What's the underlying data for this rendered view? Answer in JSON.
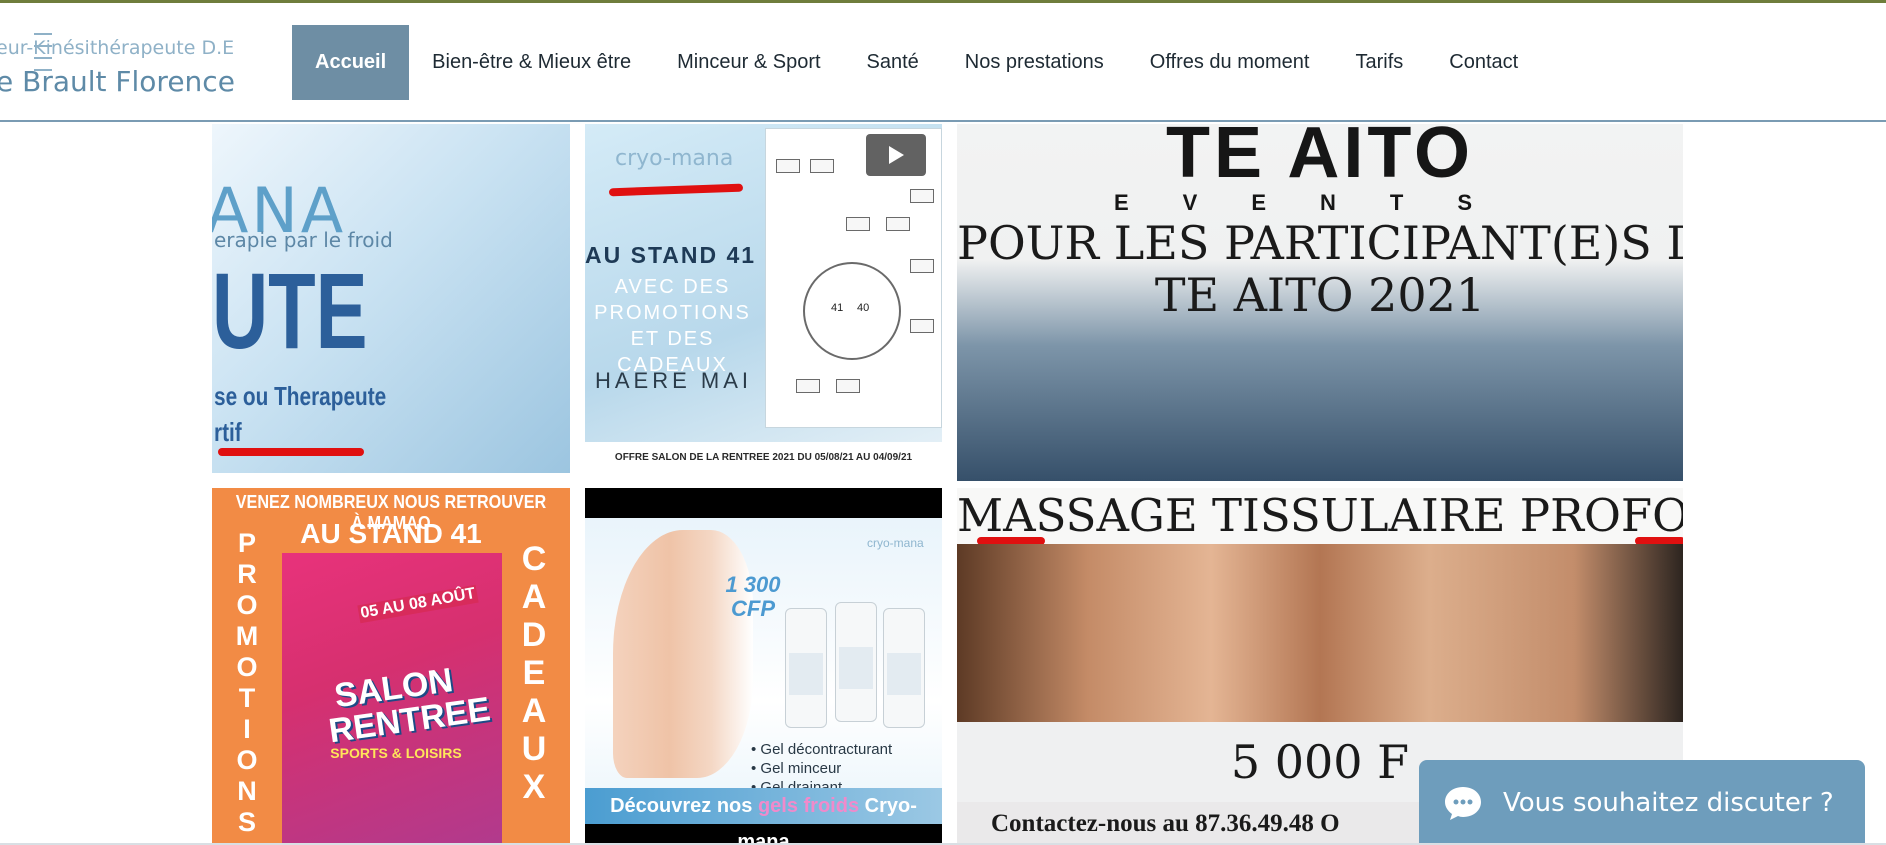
{
  "header": {
    "brand_sub": "eur-Kinésithérapeute D.E",
    "brand_name": "e Brault Florence"
  },
  "nav": {
    "items": [
      {
        "label": "Accueil",
        "active": true
      },
      {
        "label": "Bien-être & Mieux être"
      },
      {
        "label": "Minceur & Sport"
      },
      {
        "label": "Santé"
      },
      {
        "label": "Nos prestations"
      },
      {
        "label": "Offres du moment"
      },
      {
        "label": "Tarifs"
      },
      {
        "label": "Contact"
      }
    ]
  },
  "gallery": {
    "tile1": {
      "logo": "ANA",
      "sub": "erapie par le froid",
      "big": "UTE",
      "line3": "se ou Therapeute",
      "line4": "rtif"
    },
    "tile2": {
      "brand": "cryo-mana",
      "line1": "AU STAND 41",
      "line2": "AVEC DES PROMOTIONS ET DES CADEAUX",
      "line3": "HAERE MAI",
      "footer": "OFFRE SALON DE LA RENTREE 2021 DU 05/08/21 AU 04/09/21",
      "map_numbers": [
        "41",
        "40"
      ]
    },
    "tile3": {
      "title": "TE AITO",
      "subtitle": "EVENTS",
      "line1": "POUR LES PARTICIPANT(E)S DU",
      "line2": "TE AITO 2021"
    },
    "tile4": {
      "head1": "VENEZ NOMBREUX NOUS RETROUVER À MAMAO",
      "head2": "AU STAND 41",
      "left_vertical": "PROMOTIONS",
      "right_vertical": "CADEAUX",
      "poster_dates": "05 AU 08 AOÛT",
      "poster_title": "SALON RENTREE",
      "poster_sub": "SPORTS & LOISIRS"
    },
    "tile5": {
      "price": "1 300 CFP",
      "brand": "cryo-mana",
      "gels": [
        "Gel décontracturant",
        "Gel minceur",
        "Gel drainant"
      ],
      "cta_prefix": "Découvrez nos ",
      "cta_highlight": "gels froids",
      "cta_suffix": " Cryo-mana"
    },
    "tile6": {
      "title": "MASSAGE TISSULAIRE PROFOND",
      "price": "5 000 F",
      "contact": "Contactez-nous au 87.36.49.48 O"
    }
  },
  "chat": {
    "label": "Vous souhaitez discuter ?"
  },
  "colors": {
    "nav_active": "#6e8ea4",
    "accent_line": "#7a9bb3",
    "chat_bg": "#6e9dbc",
    "annotation_red": "#e01010"
  }
}
